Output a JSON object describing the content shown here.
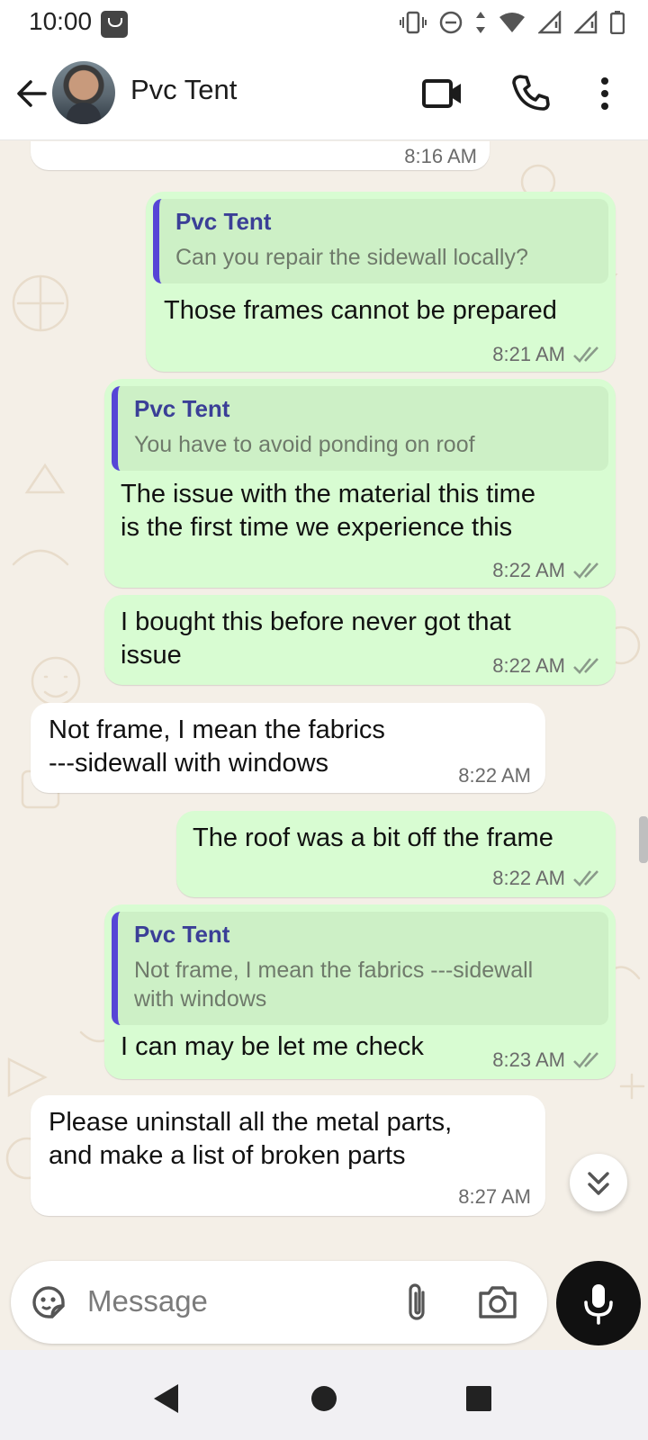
{
  "status_bar": {
    "time": "10:00"
  },
  "header": {
    "contact_name": "Pvc Tent"
  },
  "messages": [
    {
      "time": "8:16 AM"
    },
    {
      "reply_name": "Pvc Tent",
      "reply_text": "Can you repair the sidewall locally?",
      "text": "Those frames cannot be prepared",
      "time": "8:21 AM"
    },
    {
      "reply_name": "Pvc Tent",
      "reply_text": "You have to avoid ponding on roof",
      "text1": "The issue with the material this time",
      "text2": "is the first time we experience this",
      "time": "8:22 AM"
    },
    {
      "text1": "I bought this before never got that",
      "text2": "issue",
      "time": "8:22 AM"
    },
    {
      "text1": "Not frame, I mean the fabrics",
      "text2": "---sidewall with windows",
      "time": "8:22 AM"
    },
    {
      "text": "The roof was a bit off the frame",
      "time": "8:22 AM"
    },
    {
      "reply_name": "Pvc Tent",
      "reply_text1": "Not frame, I mean the fabrics ---sidewall",
      "reply_text2": "with windows",
      "text": "I can may be let me check",
      "time": "8:23 AM"
    },
    {
      "text1": "Please uninstall all the metal parts,",
      "text2": "and make a list of broken parts",
      "time": "8:27 AM"
    }
  ],
  "composer": {
    "placeholder": "Message"
  },
  "colors": {
    "outgoing": "#d8fcd2",
    "incoming": "#ffffff",
    "reply_bar": "#5645d6",
    "reply_name": "#3b3f97",
    "ticks": "#8a9a8a"
  }
}
